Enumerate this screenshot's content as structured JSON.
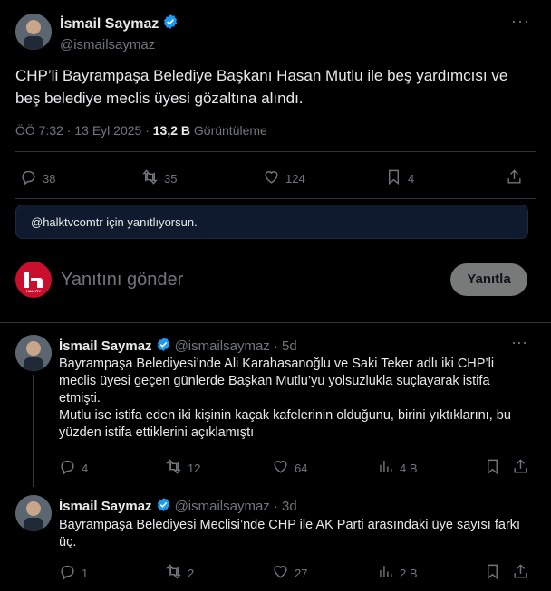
{
  "main_tweet": {
    "author_name": "İsmail Saymaz",
    "handle": "@ismailsaymaz",
    "text": "CHP’li Bayrampaşa Belediye Başkanı Hasan Mutlu ile beş yardımcısı ve beş belediye meclis üyesi gözaltına alındı.",
    "time": "ÖÖ 7:32 · 13 Eyl 2025 · ",
    "views_count": "13,2 B",
    "views_label": " Görüntüleme",
    "replies": "38",
    "retweets": "35",
    "likes": "124",
    "bookmarks": "4"
  },
  "reply_banner": {
    "text": "@halktvcomtr için yanıtlıyorsun."
  },
  "composer": {
    "avatar_text": "HALKTV",
    "placeholder": "Yanıtını gönder",
    "reply_button": "Yanıtla"
  },
  "thread": [
    {
      "author_name": "İsmail Saymaz",
      "handle": "@ismailsaymaz",
      "age": "· 5d",
      "text_1": "Bayrampaşa Belediyesi’nde Ali Karahasanoğlu ve Saki Teker adlı iki CHP’li meclis üyesi geçen günlerde Başkan Mutlu’yu yolsuzlukla suçlayarak istifa etmişti.",
      "text_2": "Mutlu ise istifa eden iki kişinin kaçak kafelerinin olduğunu, birini yıktıklarını, bu yüzden istifa ettiklerini açıklamıştı",
      "replies": "4",
      "retweets": "12",
      "likes": "64",
      "views": "4 B"
    },
    {
      "author_name": "İsmail Saymaz",
      "handle": "@ismailsaymaz",
      "age": "· 3d",
      "text_1": "Bayrampaşa Belediyesi Meclisi’nde CHP ile AK Parti arasındaki üye sayısı farkı üç.",
      "replies": "1",
      "retweets": "2",
      "likes": "27",
      "views": "2 B"
    }
  ],
  "colors": {
    "verified": "#1d9bf0",
    "muted": "#71767b",
    "banner_bg": "#0f1a2e",
    "divider": "#2f3336",
    "halktv_red": "#c8102e"
  }
}
